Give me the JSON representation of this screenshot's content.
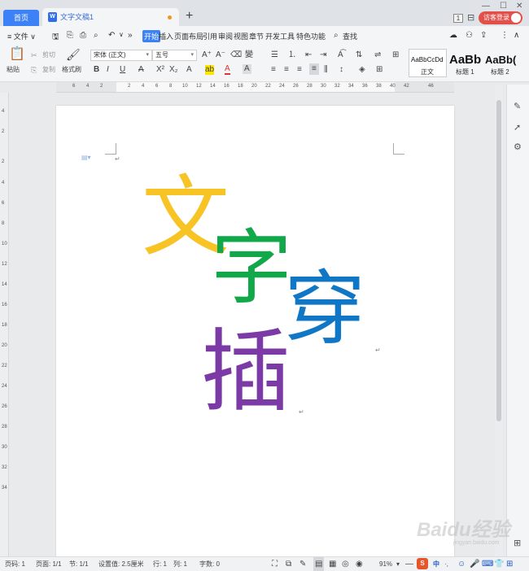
{
  "tabs": {
    "home": "首页",
    "doc": "文字文稿1"
  },
  "window": {
    "pages_badge": "1",
    "login": "访客登录"
  },
  "menu": {
    "file": "≡ 文件 ∨",
    "items": [
      "开始",
      "插入",
      "页面布局",
      "引用",
      "审阅",
      "视图",
      "章节",
      "开发工具",
      "特色功能"
    ],
    "search": "查找",
    "active_index": 0
  },
  "ribbon": {
    "paste": "粘贴",
    "cut": "剪切",
    "copy": "复制",
    "format_painter": "格式刷",
    "font_name": "宋体 (正文)",
    "font_size": "五号",
    "styles": [
      {
        "preview": "AaBbCcDd",
        "label": "正文"
      },
      {
        "preview": "AaBb",
        "label": "标题 1"
      },
      {
        "preview": "AaBb(",
        "label": "标题 2"
      }
    ]
  },
  "ruler": {
    "h_ticks": [
      "6",
      "4",
      "2",
      "2",
      "4",
      "6",
      "8",
      "10",
      "12",
      "14",
      "16",
      "18",
      "20",
      "22",
      "24",
      "26",
      "28",
      "30",
      "32",
      "34",
      "36",
      "38",
      "40",
      "42",
      "46"
    ],
    "v_ticks": [
      "4",
      "2",
      "2",
      "4",
      "6",
      "8",
      "10",
      "12",
      "14",
      "16",
      "18",
      "20",
      "22",
      "24",
      "26",
      "28",
      "30",
      "32",
      "34"
    ]
  },
  "document": {
    "chars": [
      {
        "text": "文",
        "color": "#f7c325"
      },
      {
        "text": "字",
        "color": "#11a84a"
      },
      {
        "text": "穿",
        "color": "#1077c7"
      },
      {
        "text": "插",
        "color": "#7b3aa6"
      }
    ]
  },
  "status": {
    "page_no": "页码: 1",
    "pages": "页面: 1/1",
    "section": "节: 1/1",
    "setting": "设置值: 2.5厘米",
    "row": "行: 1",
    "col": "列: 1",
    "words": "字数: 0",
    "zoom": "91%"
  },
  "watermark": {
    "brand": "Baidu经验",
    "url": "jingyan.baidu.com"
  }
}
